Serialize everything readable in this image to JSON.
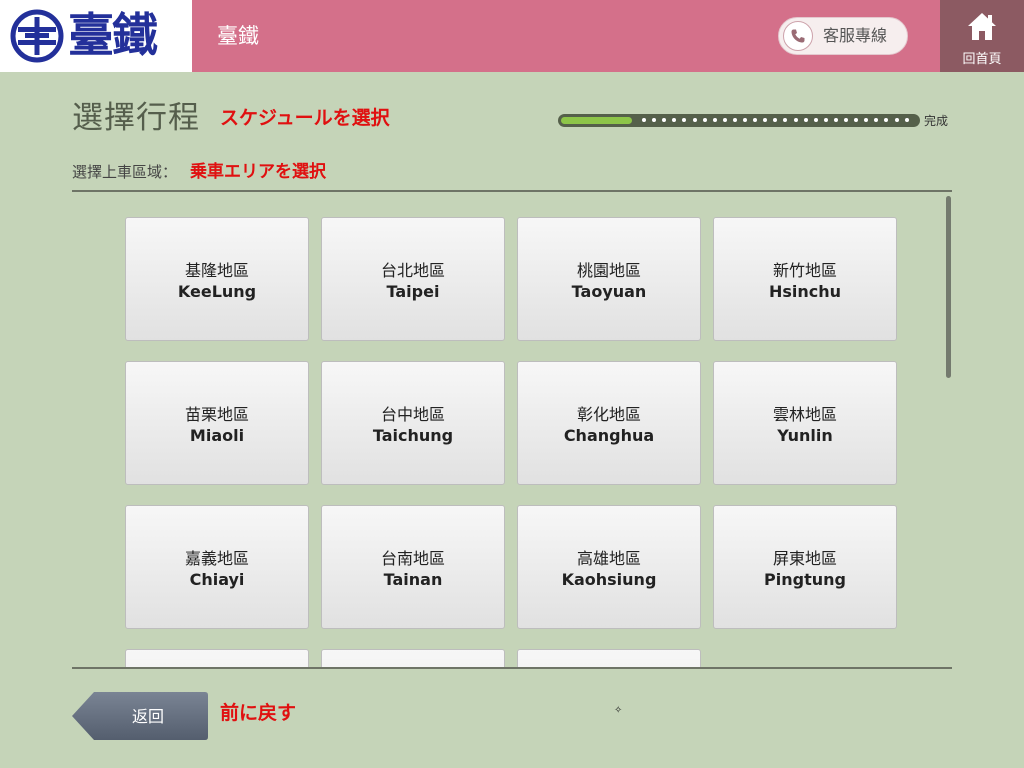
{
  "header": {
    "logo_text": "臺鐵",
    "title": "臺鐵",
    "service_label": "客服專線",
    "home_label": "回首頁"
  },
  "page": {
    "title": "選擇行程",
    "title_jp": "スケジュールを選択",
    "progress_label": "完成",
    "progress": 0.2,
    "subtitle": "選擇上車區域：",
    "subtitle_jp": "乗車エリアを選択"
  },
  "regions": [
    {
      "zh": "基隆地區",
      "en": "KeeLung"
    },
    {
      "zh": "台北地區",
      "en": "Taipei"
    },
    {
      "zh": "桃園地區",
      "en": "Taoyuan"
    },
    {
      "zh": "新竹地區",
      "en": "Hsinchu"
    },
    {
      "zh": "苗栗地區",
      "en": "Miaoli"
    },
    {
      "zh": "台中地區",
      "en": "Taichung"
    },
    {
      "zh": "彰化地區",
      "en": "Changhua"
    },
    {
      "zh": "雲林地區",
      "en": "Yunlin"
    },
    {
      "zh": "嘉義地區",
      "en": "Chiayi"
    },
    {
      "zh": "台南地區",
      "en": "Tainan"
    },
    {
      "zh": "高雄地區",
      "en": "Kaohsiung"
    },
    {
      "zh": "屏東地區",
      "en": "Pingtung"
    },
    {
      "zh": "",
      "en": ""
    },
    {
      "zh": "",
      "en": ""
    },
    {
      "zh": "",
      "en": ""
    }
  ],
  "footer": {
    "back_label": "返回",
    "back_jp": "前に戻す"
  },
  "colors": {
    "header_bg": "#d4708a",
    "home_bg": "#8c5a62",
    "page_bg": "#c5d4b8",
    "accent_red": "#e01010",
    "progress_fill": "#8dc548",
    "logo_blue": "#23309a"
  },
  "icons": {
    "logo": "tra-logo-icon",
    "phone": "phone-icon",
    "home": "home-icon"
  }
}
